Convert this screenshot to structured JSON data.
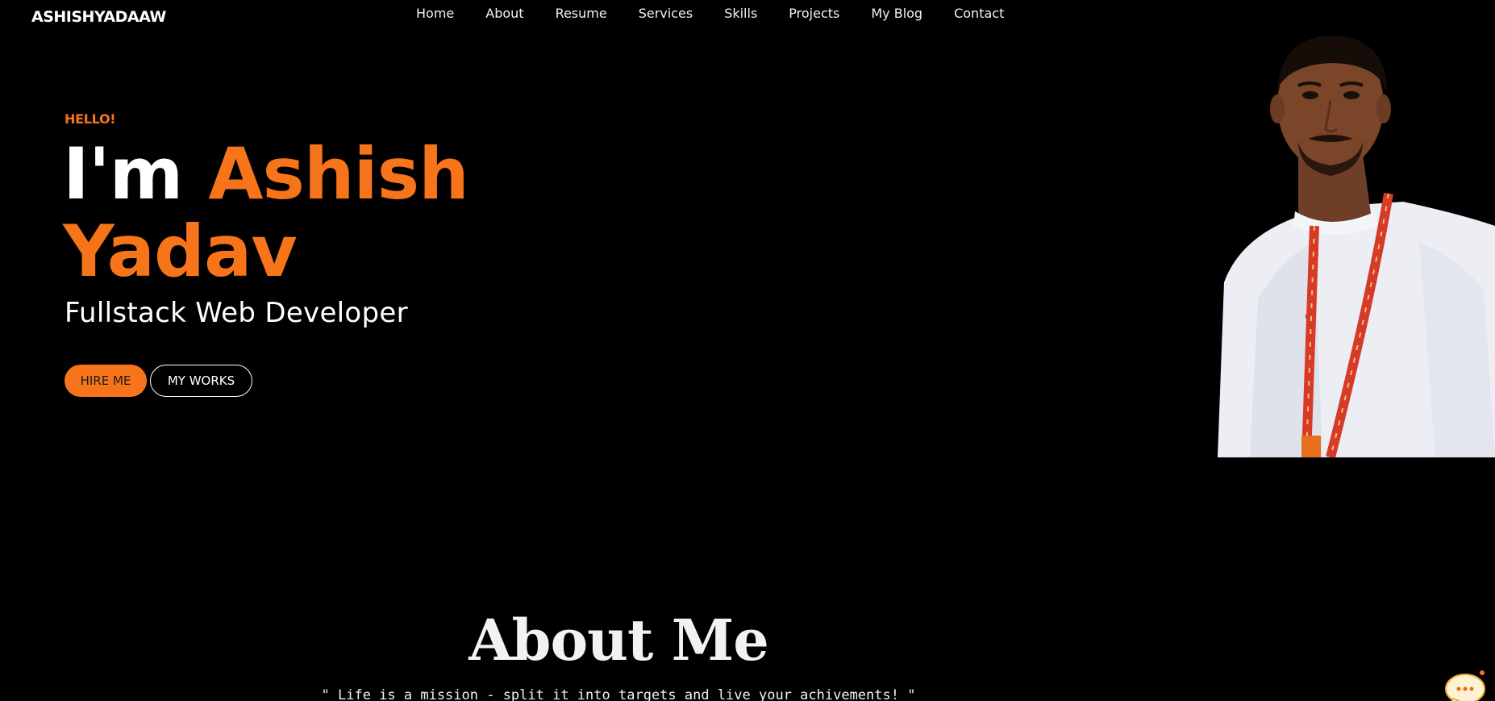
{
  "header": {
    "brand": "ASHISHYADAAW",
    "nav": [
      "Home",
      "About",
      "Resume",
      "Services",
      "Skills",
      "Projects",
      "My Blog",
      "Contact"
    ]
  },
  "hero": {
    "greeting": "HELLO!",
    "im": "I'm",
    "first_name": "Ashish",
    "last_name": "Yadav",
    "role": "Fullstack Web Developer",
    "hire_button": "HIRE ME",
    "works_button": "MY WORKS"
  },
  "about": {
    "title": "About Me",
    "quote": "\" Life is a mission - split it into targets and live your achivements! \""
  },
  "chat": {
    "icon": "chat-bubble-icon"
  },
  "colors": {
    "accent": "#f7741b",
    "background": "#000000",
    "text": "#ffffff"
  }
}
